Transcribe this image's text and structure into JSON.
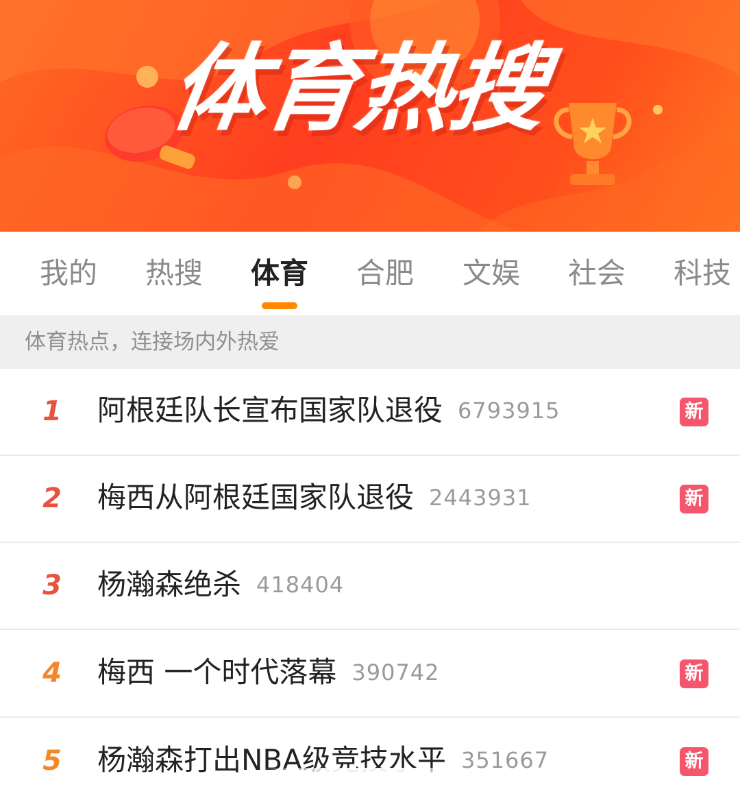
{
  "banner": {
    "title": "体育热搜"
  },
  "tabs": [
    {
      "label": "我的",
      "active": false
    },
    {
      "label": "热搜",
      "active": false
    },
    {
      "label": "体育",
      "active": true
    },
    {
      "label": "合肥",
      "active": false
    },
    {
      "label": "文娱",
      "active": false
    },
    {
      "label": "社会",
      "active": false
    },
    {
      "label": "科技",
      "active": false
    }
  ],
  "subtitle": "体育热点，连接场内外热爱",
  "badge_label": "新",
  "colors": {
    "banner": "#ff4a1f",
    "tab_indicator": "#ff8a00",
    "rank_top": "#e8533f",
    "rank_mid": "#f5862a",
    "badge": "#f5566b"
  },
  "items": [
    {
      "rank": "1",
      "title": "阿根廷队长宣布国家队退役",
      "count": "6793915",
      "badge": true
    },
    {
      "rank": "2",
      "title": "梅西从阿根廷国家队退役",
      "count": "2443931",
      "badge": true
    },
    {
      "rank": "3",
      "title": "杨瀚森绝杀",
      "count": "418404",
      "badge": false
    },
    {
      "rank": "4",
      "title": "梅西 一个时代落幕",
      "count": "390742",
      "badge": true
    },
    {
      "rank": "5",
      "title": "杨瀚森打出NBA级竞技水平",
      "count": "351667",
      "badge": true
    }
  ],
  "icons": [
    "ping-pong-paddle-icon",
    "trophy-icon",
    "basketball-icon"
  ]
}
